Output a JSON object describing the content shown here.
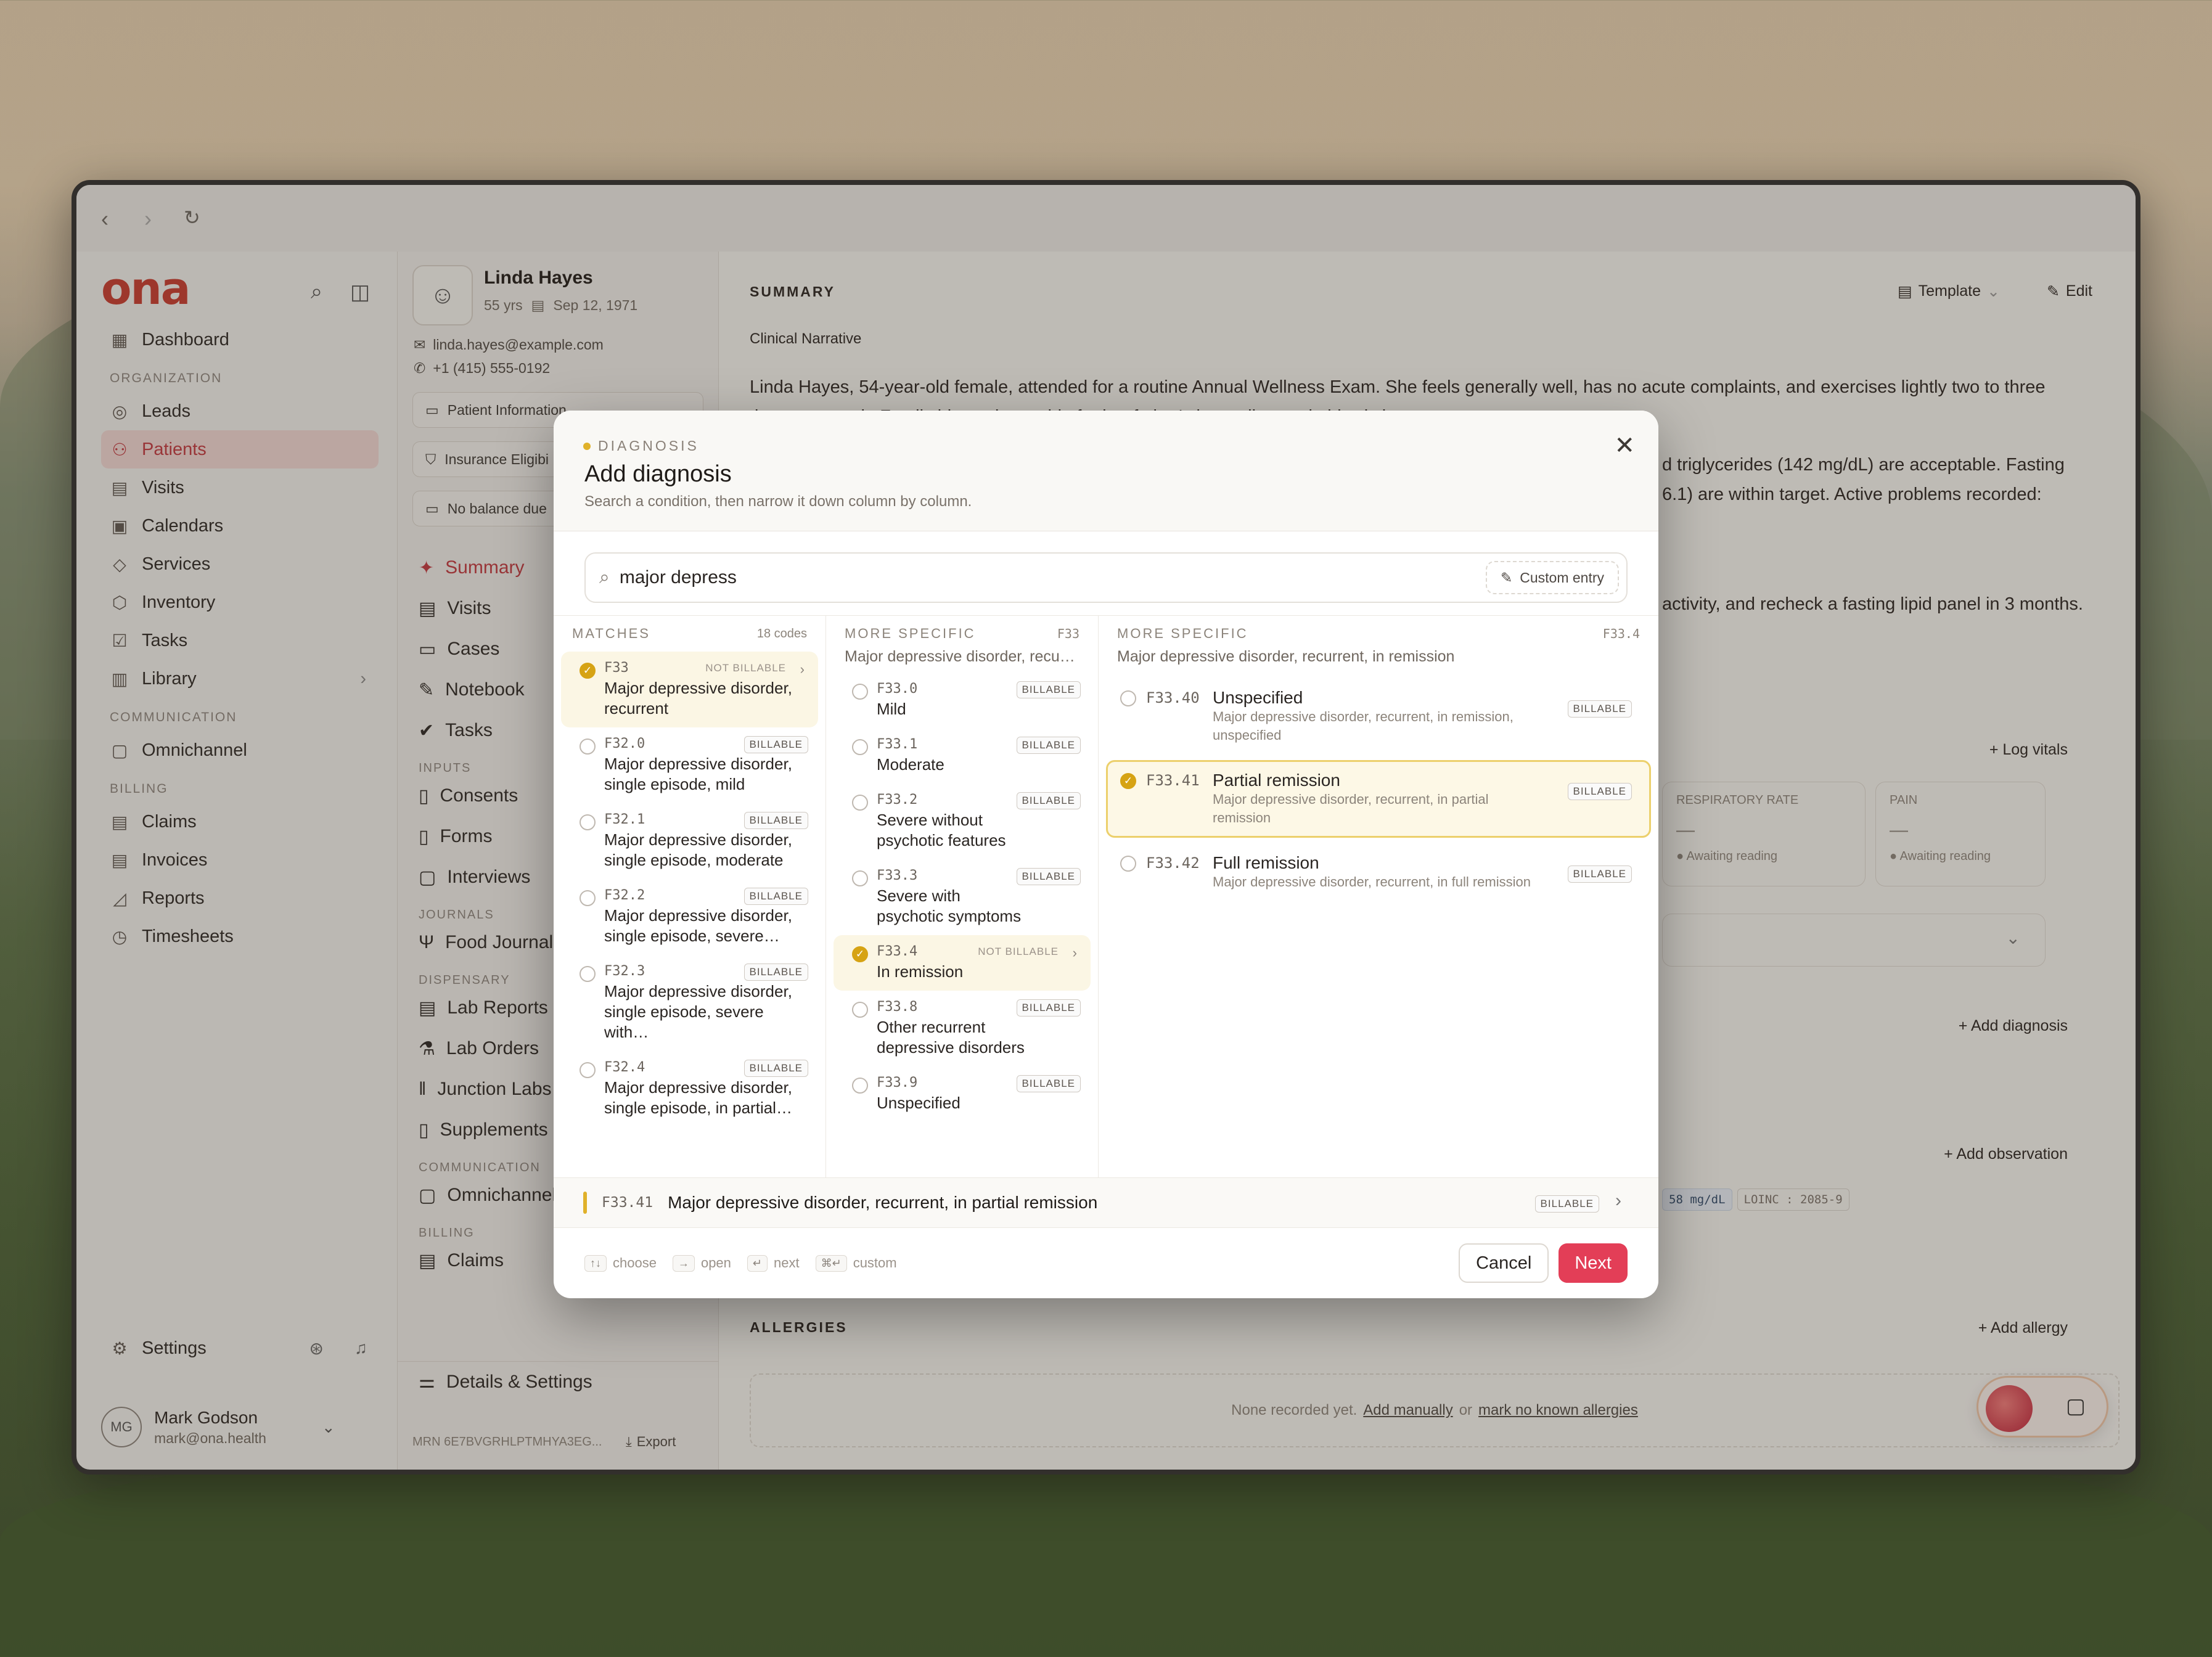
{
  "browser": {
    "back": "‹",
    "forward": "›",
    "reload": "↻"
  },
  "sidebar": {
    "logo": "ona",
    "sections": {
      "organization": "ORGANIZATION",
      "communication": "COMMUNICATION",
      "billing": "BILLING"
    },
    "items": [
      {
        "label": "Dashboard"
      },
      {
        "label": "Leads"
      },
      {
        "label": "Patients"
      },
      {
        "label": "Visits"
      },
      {
        "label": "Calendars"
      },
      {
        "label": "Services"
      },
      {
        "label": "Inventory"
      },
      {
        "label": "Tasks"
      },
      {
        "label": "Library"
      },
      {
        "label": "Omnichannel"
      },
      {
        "label": "Claims"
      },
      {
        "label": "Invoices"
      },
      {
        "label": "Reports"
      },
      {
        "label": "Timesheets"
      }
    ],
    "settings": "Settings",
    "user": {
      "initials": "MG",
      "name": "Mark Godson",
      "email": "mark@ona.health"
    }
  },
  "patient": {
    "name": "Linda Hayes",
    "age": "55 yrs",
    "dob": "Sep 12, 1971",
    "email": "linda.hayes@example.com",
    "phone": "+1 (415) 555-0192",
    "chips": [
      "Patient Information",
      "Insurance Eligibi",
      "No balance due"
    ],
    "nav": [
      {
        "label": "Summary"
      },
      {
        "label": "Visits"
      },
      {
        "label": "Cases"
      },
      {
        "label": "Notebook"
      },
      {
        "label": "Tasks"
      }
    ],
    "sec_inputs": "INPUTS",
    "inputs": [
      "Consents",
      "Forms",
      "Interviews"
    ],
    "sec_journals": "JOURNALS",
    "journals": [
      "Food Journal"
    ],
    "sec_dispensary": "DISPENSARY",
    "dispensary": [
      "Lab Reports",
      "Lab Orders",
      "Junction Labs",
      "Supplements"
    ],
    "sec_comm": "COMMUNICATION",
    "comm": [
      "Omnichannel"
    ],
    "sec_billing": "BILLING",
    "billing": [
      "Claims"
    ],
    "details": "Details & Settings",
    "mrn": "MRN 6E7BVGRHLPTMHYA3EG...",
    "export": "Export"
  },
  "main": {
    "summary": "SUMMARY",
    "template": "Template",
    "edit": "Edit",
    "narrative_title": "Clinical Narrative",
    "narrative_1": "Linda Hayes, 54-year-old female, attended for a routine Annual Wellness Exam. She feels generally well, has no acute complaints, and exercises lightly two to three",
    "narrative_1b": "times per week. Family history is notable for her father's heart disease in his sixties.",
    "narrative_2": "d triglycerides (142 mg/dL) are acceptable. Fasting",
    "narrative_3": "6.1) are within target. Active problems recorded:",
    "narrative_4": "activity, and recheck a fasting lipid panel in 3 months.",
    "log_vitals": "Log vitals",
    "resp_rate": "RESPIRATORY RATE",
    "pain": "PAIN",
    "dash": "—",
    "awaiting": "Awaiting reading",
    "add_diagnosis": "Add diagnosis",
    "add_observation": "Add observation",
    "obs_value": "58 mg/dL",
    "loinc": "LOINC : 2085-9",
    "allergies": "ALLERGIES",
    "add_allergy": "Add allergy",
    "none_recorded": "None recorded yet.",
    "add_manually": "Add manually",
    "or": "or",
    "mark_nka": "mark no known allergies"
  },
  "modal": {
    "kicker": "DIAGNOSIS",
    "title": "Add diagnosis",
    "subtitle": "Search a condition, then narrow it down column by column.",
    "search_value": "major depress",
    "custom_entry": "Custom entry",
    "col1": {
      "title": "MATCHES",
      "count": "18 codes",
      "rows": [
        {
          "code": "F33",
          "badge": "NOT BILLABLE",
          "name": "Major depressive disorder, recurrent",
          "selected": true
        },
        {
          "code": "F32.0",
          "badge": "BILLABLE",
          "name": "Major depressive disorder, single episode, mild"
        },
        {
          "code": "F32.1",
          "badge": "BILLABLE",
          "name": "Major depressive disorder, single episode, moderate"
        },
        {
          "code": "F32.2",
          "badge": "BILLABLE",
          "name": "Major depressive disorder, single episode, severe…"
        },
        {
          "code": "F32.3",
          "badge": "BILLABLE",
          "name": "Major depressive disorder, single episode, severe with…"
        },
        {
          "code": "F32.4",
          "badge": "BILLABLE",
          "name": "Major depressive disorder, single episode, in partial…"
        }
      ]
    },
    "col2": {
      "title": "MORE SPECIFIC",
      "code": "F33",
      "path": "Major depressive disorder, recu…",
      "rows": [
        {
          "code": "F33.0",
          "badge": "BILLABLE",
          "name": "Mild"
        },
        {
          "code": "F33.1",
          "badge": "BILLABLE",
          "name": "Moderate"
        },
        {
          "code": "F33.2",
          "badge": "BILLABLE",
          "name": "Severe without psychotic features"
        },
        {
          "code": "F33.3",
          "badge": "BILLABLE",
          "name": "Severe with psychotic symptoms"
        },
        {
          "code": "F33.4",
          "badge": "NOT BILLABLE",
          "name": "In remission",
          "selected": true
        },
        {
          "code": "F33.8",
          "badge": "BILLABLE",
          "name": "Other recurrent depressive disorders"
        },
        {
          "code": "F33.9",
          "badge": "BILLABLE",
          "name": "Unspecified"
        }
      ]
    },
    "col3": {
      "title": "MORE SPECIFIC",
      "code": "F33.4",
      "path": "Major depressive disorder, recurrent, in remission",
      "rows": [
        {
          "code": "F33.40",
          "badge": "BILLABLE",
          "name": "Unspecified",
          "desc": "Major depressive disorder, recurrent, in remission, unspecified"
        },
        {
          "code": "F33.41",
          "badge": "BILLABLE",
          "name": "Partial remission",
          "desc": "Major depressive disorder, recurrent, in partial remission",
          "selected": true
        },
        {
          "code": "F33.42",
          "badge": "BILLABLE",
          "name": "Full remission",
          "desc": "Major depressive disorder, recurrent, in full remission"
        }
      ]
    },
    "selection": {
      "code": "F33.41",
      "name": "Major depressive disorder, recurrent, in partial remission",
      "badge": "BILLABLE"
    },
    "hints": [
      {
        "key": "↑↓",
        "label": "choose"
      },
      {
        "key": "→",
        "label": "open"
      },
      {
        "key": "↵",
        "label": "next"
      },
      {
        "key": "⌘↵",
        "label": "custom"
      }
    ],
    "cancel": "Cancel",
    "next": "Next"
  },
  "colors": {
    "brand": "#c83a2f",
    "accent": "#e33e57",
    "selected": "#d6a314"
  }
}
